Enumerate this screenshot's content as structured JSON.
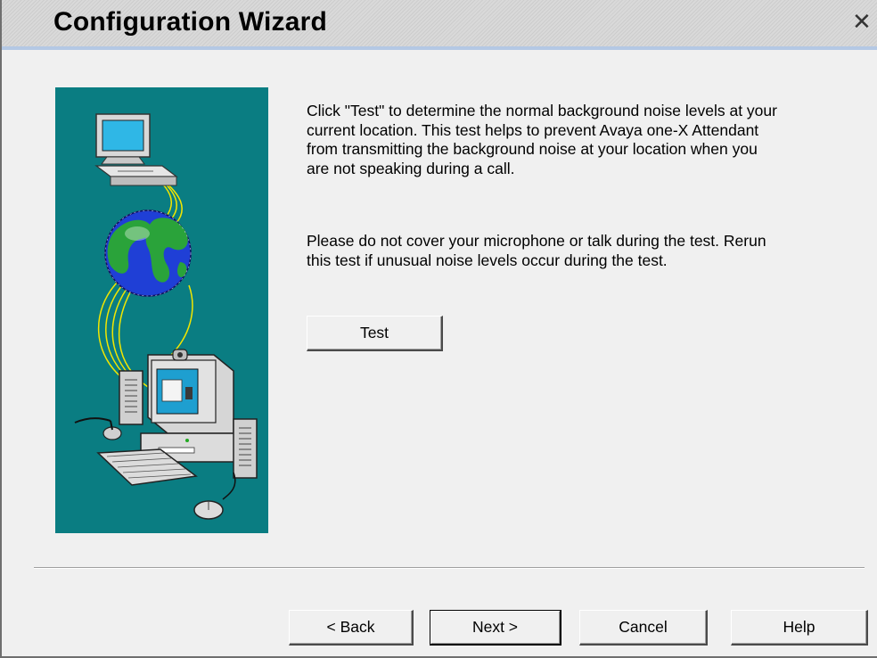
{
  "window": {
    "title": "Configuration Wizard",
    "close_glyph": "✕"
  },
  "content": {
    "paragraph1": "Click \"Test\" to determine the normal background noise levels at your current location. This test helps to prevent Avaya one-X Attendant from transmitting the background noise at your location when you are not speaking during a call.",
    "paragraph2": "Please do not cover your microphone or talk during the test. Rerun this test if unusual noise levels occur during the test.",
    "test_label": "Test"
  },
  "footer": {
    "back_label": "< Back",
    "next_label": "Next >",
    "cancel_label": "Cancel",
    "help_label": "Help"
  },
  "colors": {
    "illustration_bg": "#0a7d82",
    "title_underline": "#b4c8e4"
  },
  "icons": [
    "close-icon",
    "network-computers-illustration"
  ]
}
